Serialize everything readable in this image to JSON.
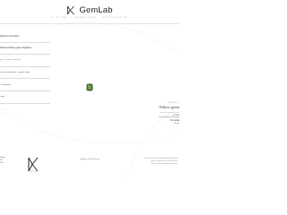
{
  "header": {
    "brand_name": "GemLab",
    "tagline": "DIGITAL · GEMSTONE · REFERENCE"
  },
  "specs": [
    {
      "value": "Natural Corundum"
    },
    {
      "value": "Natural Yellow-green Sapphire"
    },
    {
      "value": "0.57 × 4.61 × 3.21 mm"
    },
    {
      "value": "Cushion Modified · Brilliant Step"
    },
    {
      "value": "Transparent"
    },
    {
      "value": "Heat"
    }
  ],
  "spec_footnotes": [
    "· · · · · ·",
    "· · · · · ·",
    "· · · · · ·"
  ],
  "right_panel": {
    "label": "VARIETY",
    "variety": "Yellow-green",
    "lines": [
      "ORIGIN",
      "No indications of heating",
      "Sri Lanka",
      "Ceylon"
    ]
  },
  "footer": {
    "logo_sub": "GEMLAB",
    "center_text": "Images and the listing",
    "right_lines": [
      "This report is not a guarantee. All information",
      "herein is subject to the terms below.",
      "© 2024 GemLab. All rights reserved."
    ],
    "left_lines": [
      "Report",
      "No.",
      "Date"
    ]
  },
  "colors": {
    "gem_primary": "#3f6b2e",
    "gem_highlight": "#b7d29a",
    "rule": "#dcdcdc"
  }
}
